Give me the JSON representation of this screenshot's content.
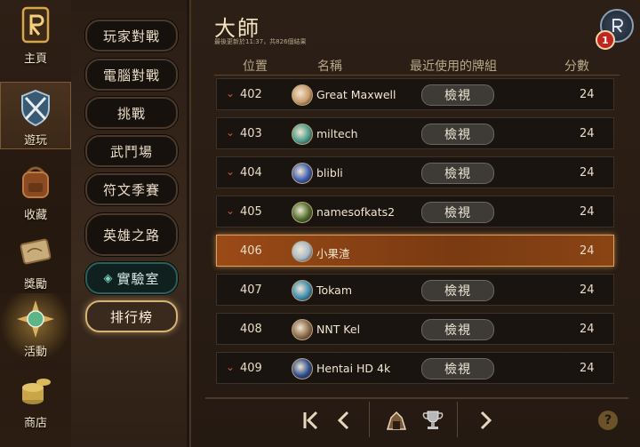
{
  "rail": {
    "items": [
      {
        "label": "主頁",
        "icon": "runeterra-logo-icon"
      },
      {
        "label": "遊玩",
        "icon": "crossed-swords-shield-icon"
      },
      {
        "label": "收藏",
        "icon": "backpack-icon"
      },
      {
        "label": "獎勵",
        "icon": "scroll-map-icon"
      },
      {
        "label": "活動",
        "icon": "gem-star-icon"
      },
      {
        "label": "商店",
        "icon": "coin-stack-icon"
      }
    ]
  },
  "menu": {
    "items": [
      {
        "label": "玩家對戰"
      },
      {
        "label": "電腦對戰"
      },
      {
        "label": "挑戰"
      },
      {
        "label": "武鬥場"
      },
      {
        "label": "符文季賽"
      },
      {
        "label": "英雄之路"
      },
      {
        "label": "實驗室"
      },
      {
        "label": "排行榜"
      }
    ]
  },
  "leaderboard": {
    "title": "大師",
    "subtitle": "最後更新於11:37，共826個結果",
    "notification_count": "1",
    "columns": {
      "rank": "位置",
      "name": "名稱",
      "deck": "最近使用的牌組",
      "score": "分數"
    },
    "view_label": "檢視",
    "rows": [
      {
        "rank": "402",
        "name": "Great Maxwell",
        "score": "24",
        "trend": "down"
      },
      {
        "rank": "403",
        "name": "miltech",
        "score": "24",
        "trend": "down"
      },
      {
        "rank": "404",
        "name": "blibli",
        "score": "24",
        "trend": "down"
      },
      {
        "rank": "405",
        "name": "namesofkats2",
        "score": "24",
        "trend": "down"
      },
      {
        "rank": "406",
        "name": "小果渣",
        "score": "24",
        "trend": "none",
        "highlight": true
      },
      {
        "rank": "407",
        "name": "Tokam",
        "score": "24",
        "trend": "none"
      },
      {
        "rank": "408",
        "name": "NNT Kel",
        "score": "24",
        "trend": "none"
      },
      {
        "rank": "409",
        "name": "Hentai HD 4k",
        "score": "24",
        "trend": "down"
      }
    ],
    "help_label": "?"
  },
  "colors": {
    "accent": "#d5b374",
    "highlight_row": "#9a4a16",
    "trend_down": "#d0583c"
  }
}
